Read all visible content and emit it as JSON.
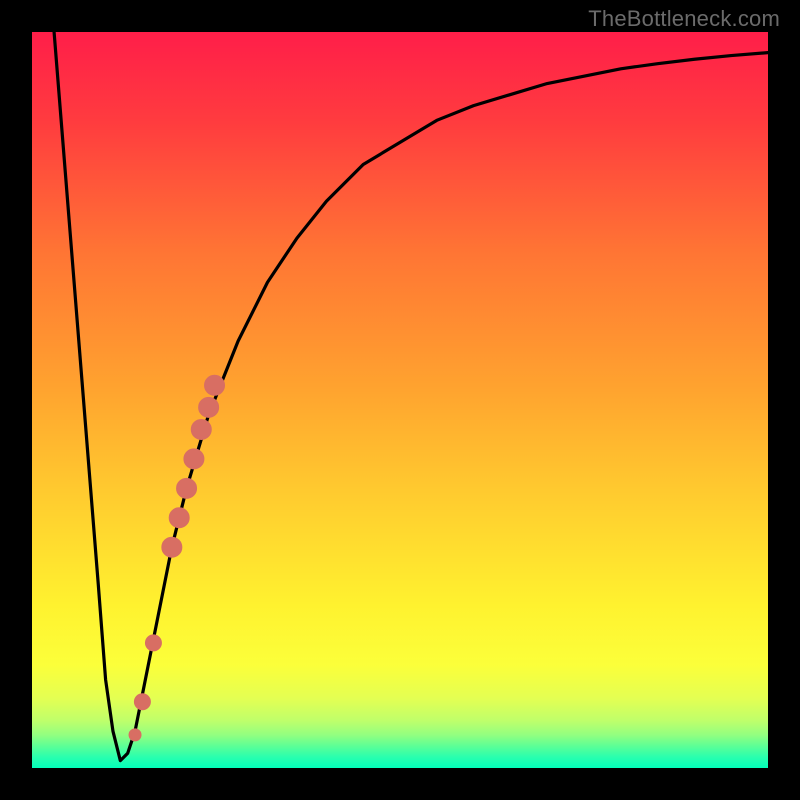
{
  "watermark": "TheBottleneck.com",
  "colors": {
    "frame": "#000000",
    "curve": "#000000",
    "marker_fill": "#d86e63",
    "marker_stroke": "#d86e63",
    "gradient_stops": [
      {
        "offset": 0.0,
        "color": "#ff1e49"
      },
      {
        "offset": 0.12,
        "color": "#ff3b3f"
      },
      {
        "offset": 0.3,
        "color": "#ff7534"
      },
      {
        "offset": 0.48,
        "color": "#ffa22f"
      },
      {
        "offset": 0.62,
        "color": "#ffc92f"
      },
      {
        "offset": 0.78,
        "color": "#fff22f"
      },
      {
        "offset": 0.86,
        "color": "#fbff3a"
      },
      {
        "offset": 0.905,
        "color": "#e4ff52"
      },
      {
        "offset": 0.935,
        "color": "#c0ff6a"
      },
      {
        "offset": 0.955,
        "color": "#93ff80"
      },
      {
        "offset": 0.97,
        "color": "#5dff96"
      },
      {
        "offset": 0.985,
        "color": "#2affae"
      },
      {
        "offset": 1.0,
        "color": "#02ffba"
      }
    ]
  },
  "chart_data": {
    "type": "line",
    "title": "",
    "xlabel": "",
    "ylabel": "",
    "xlim": [
      0,
      100
    ],
    "ylim": [
      0,
      100
    ],
    "series": [
      {
        "name": "bottleneck-curve",
        "x": [
          3,
          5,
          7,
          9,
          10,
          11,
          12,
          13,
          14,
          15,
          17,
          19,
          21,
          24,
          28,
          32,
          36,
          40,
          45,
          50,
          55,
          60,
          65,
          70,
          75,
          80,
          85,
          90,
          95,
          100
        ],
        "y": [
          100,
          75,
          50,
          25,
          12,
          5,
          1,
          2,
          5,
          10,
          20,
          30,
          38,
          48,
          58,
          66,
          72,
          77,
          82,
          85,
          88,
          90,
          91.5,
          93,
          94,
          95,
          95.7,
          96.3,
          96.8,
          97.2
        ]
      }
    ],
    "markers": {
      "name": "highlighted-range",
      "x": [
        14.0,
        15.0,
        16.5,
        19.0,
        20.0,
        21.0,
        22.0,
        23.0,
        24.0,
        24.8
      ],
      "y": [
        4.5,
        9,
        17,
        30,
        34,
        38,
        42,
        46,
        49,
        52
      ],
      "size": [
        6,
        8,
        8,
        10,
        10,
        10,
        10,
        10,
        10,
        10
      ]
    }
  }
}
